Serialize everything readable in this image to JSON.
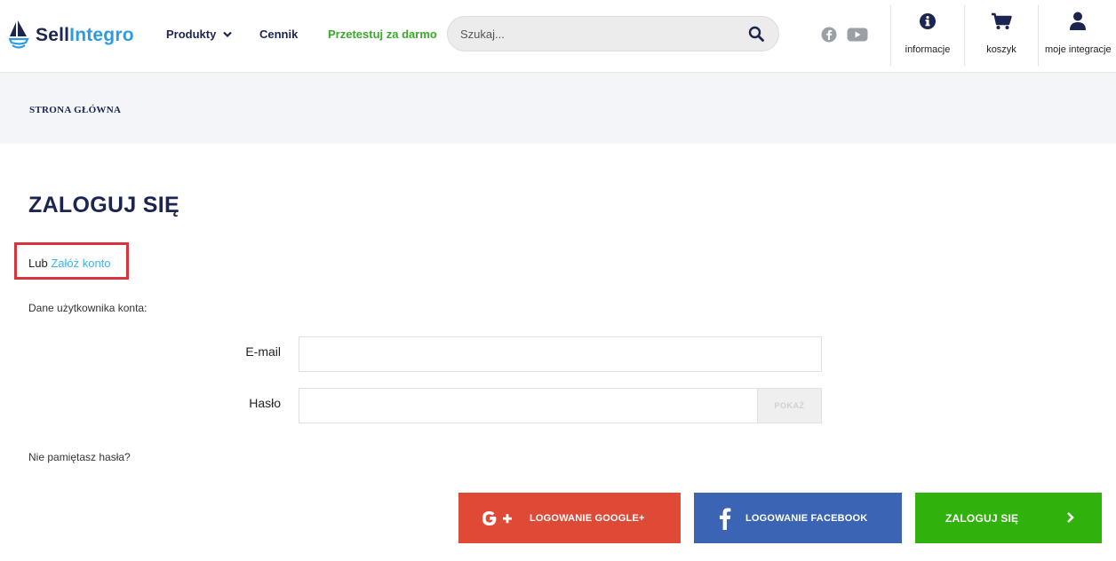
{
  "header": {
    "logo": {
      "part1": "Sell",
      "part2": "Integro"
    },
    "nav": [
      {
        "label": "Produkty"
      },
      {
        "label": "Cennik"
      },
      {
        "label": "Przetestuj za darmo"
      }
    ],
    "search": {
      "placeholder": "Szukaj..."
    },
    "social": [
      "facebook-icon",
      "youtube-icon"
    ],
    "icons": [
      {
        "label": "informacje",
        "icon": "info-icon"
      },
      {
        "label": "koszyk",
        "icon": "cart-icon"
      },
      {
        "label": "moje integracje",
        "icon": "user-icon"
      }
    ]
  },
  "breadcrumb": {
    "home": "STRONA GŁÓWNA"
  },
  "login": {
    "title": "ZALOGUJ SIĘ",
    "or_prefix": "Lub",
    "register_link": "Załóż konto",
    "section_label": "Dane użytkownika konta:",
    "email_label": "E-mail",
    "password_label": "Hasło",
    "show_label": "POKAŻ",
    "forgot": "Nie pamiętasz hasła?",
    "google_button": "LOGOWANIE GOOGLE+",
    "facebook_button": "LOGOWANIE FACEBOOK",
    "login_button": "ZALOGUJ SIĘ"
  },
  "colors": {
    "brand_dark": "#1b2550",
    "brand_blue": "#2c9be0",
    "trial_green": "#3aa82a",
    "google_red": "#df4a37",
    "facebook_blue": "#3b64b4",
    "login_green": "#31b10b",
    "highlight_red": "#d9343b",
    "link_blue": "#3ab4e9"
  }
}
